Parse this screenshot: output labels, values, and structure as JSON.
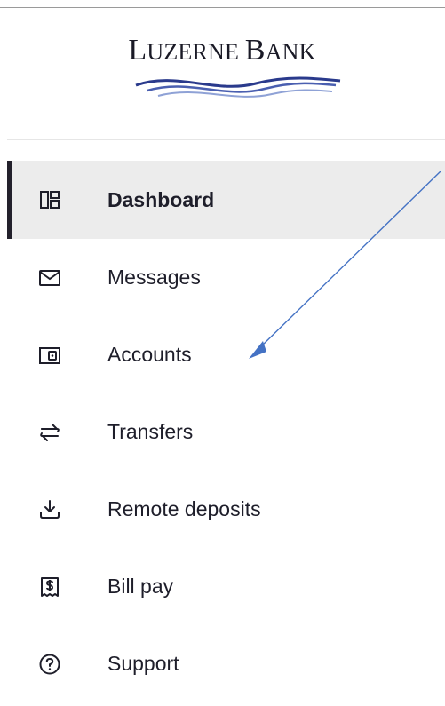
{
  "brand": {
    "name_part1_initial": "L",
    "name_part1_rest": "UZERNE",
    "name_part2_initial": "B",
    "name_part2_rest": "ANK"
  },
  "nav": {
    "active_index": 0,
    "items": [
      {
        "label": "Dashboard",
        "icon": "dashboard-icon"
      },
      {
        "label": "Messages",
        "icon": "envelope-icon"
      },
      {
        "label": "Accounts",
        "icon": "wallet-icon"
      },
      {
        "label": "Transfers",
        "icon": "transfer-arrows-icon"
      },
      {
        "label": "Remote deposits",
        "icon": "download-tray-icon"
      },
      {
        "label": "Bill pay",
        "icon": "receipt-dollar-icon"
      },
      {
        "label": "Support",
        "icon": "help-circle-icon"
      }
    ]
  },
  "colors": {
    "text": "#1e1e2a",
    "active_bg": "#ececec",
    "active_bar": "#23212c",
    "annotation_arrow": "#4472c4",
    "logo_wave_dark": "#2a3a8c",
    "logo_wave_light": "#8fa2d6"
  }
}
